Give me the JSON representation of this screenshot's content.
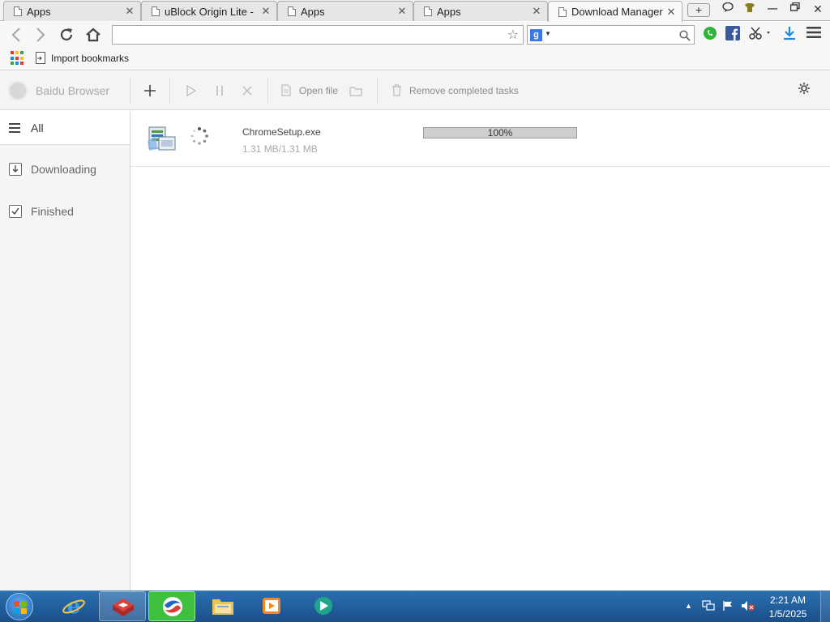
{
  "browser": {
    "tabs": [
      {
        "title": "Apps"
      },
      {
        "title": "uBlock Origin Lite -"
      },
      {
        "title": "Apps"
      },
      {
        "title": "Apps"
      },
      {
        "title": "Download Manager"
      }
    ],
    "active_tab_index": 4,
    "address": "",
    "search_engine": "g",
    "bookmarks": [
      {
        "label": "Import bookmarks"
      }
    ]
  },
  "download_manager": {
    "brand": "Baidu Browser",
    "toolbar": {
      "open_file_label": "Open file",
      "remove_completed_label": "Remove completed tasks"
    },
    "sidebar": [
      {
        "label": "All",
        "active": true
      },
      {
        "label": "Downloading",
        "active": false
      },
      {
        "label": "Finished",
        "active": false
      }
    ],
    "downloads": [
      {
        "filename": "ChromeSetup.exe",
        "size": "1.31 MB/1.31 MB",
        "progress_text": "100%",
        "progress": 1.0
      }
    ]
  },
  "taskbar": {
    "clock_time": "2:21 AM",
    "clock_date": "1/5/2025"
  },
  "colors": {
    "apps_grid": [
      "#e53935",
      "#fbc02d",
      "#43a047",
      "#1e88e5",
      "#e53935",
      "#fbc02d",
      "#43a047",
      "#1e88e5",
      "#e53935"
    ],
    "taskbar": "#1f5c9c",
    "active_task": "#3fbf3f"
  }
}
